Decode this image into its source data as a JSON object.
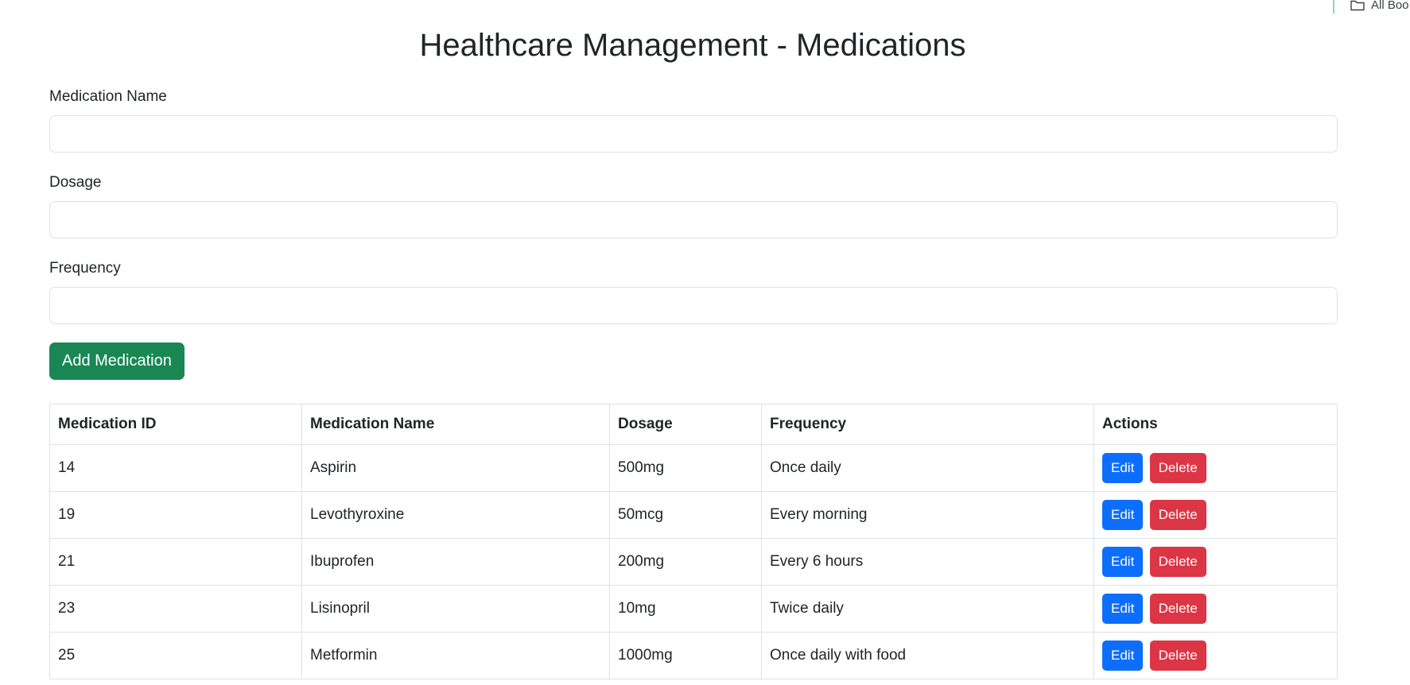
{
  "bookmarks": {
    "label": "All Boo"
  },
  "title": "Healthcare Management - Medications",
  "form": {
    "fields": [
      {
        "label": "Medication Name",
        "value": "",
        "placeholder": ""
      },
      {
        "label": "Dosage",
        "value": "",
        "placeholder": ""
      },
      {
        "label": "Frequency",
        "value": "",
        "placeholder": ""
      }
    ],
    "submit_label": "Add Medication"
  },
  "table": {
    "headers": [
      "Medication ID",
      "Medication Name",
      "Dosage",
      "Frequency",
      "Actions"
    ],
    "rows": [
      {
        "id": "14",
        "name": "Aspirin",
        "dosage": "500mg",
        "frequency": "Once daily",
        "edit": "Edit",
        "delete": "Delete"
      },
      {
        "id": "19",
        "name": "Levothyroxine",
        "dosage": "50mcg",
        "frequency": "Every morning",
        "edit": "Edit",
        "delete": "Delete"
      },
      {
        "id": "21",
        "name": "Ibuprofen",
        "dosage": "200mg",
        "frequency": "Every 6 hours",
        "edit": "Edit",
        "delete": "Delete"
      },
      {
        "id": "23",
        "name": "Lisinopril",
        "dosage": "10mg",
        "frequency": "Twice daily",
        "edit": "Edit",
        "delete": "Delete"
      },
      {
        "id": "25",
        "name": "Metformin",
        "dosage": "1000mg",
        "frequency": "Once daily with food",
        "edit": "Edit",
        "delete": "Delete"
      }
    ]
  },
  "colors": {
    "success": "#198754",
    "primary": "#0d6efd",
    "danger": "#dc3545",
    "border": "#dee2e6"
  },
  "icons": {
    "bookmarks": "folder-icon"
  }
}
